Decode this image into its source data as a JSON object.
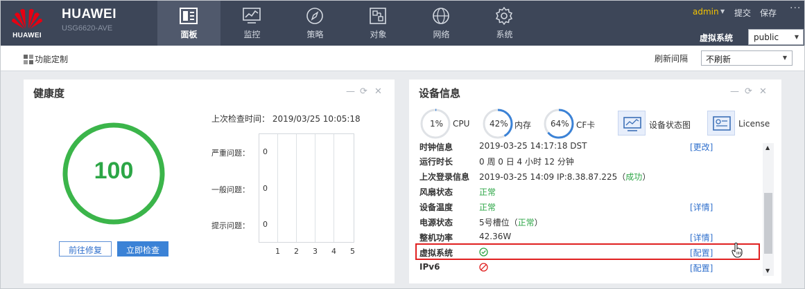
{
  "header": {
    "logo_text": "HUAWEI",
    "brand": "HUAWEI",
    "model": "USG6620-AVE",
    "nav": [
      {
        "label": "面板",
        "icon": "dashboard-icon",
        "active": true
      },
      {
        "label": "监控",
        "icon": "monitor-icon",
        "active": false
      },
      {
        "label": "策略",
        "icon": "compass-icon",
        "active": false
      },
      {
        "label": "对象",
        "icon": "object-icon",
        "active": false
      },
      {
        "label": "网络",
        "icon": "globe-icon",
        "active": false
      },
      {
        "label": "系统",
        "icon": "gear-icon",
        "active": false
      }
    ],
    "user": "admin",
    "submit": "提交",
    "save": "保存",
    "more": "···",
    "vsys_label": "虚拟系统",
    "vsys_value": "public"
  },
  "toolbar": {
    "custom_label": "功能定制",
    "refresh_label": "刷新间隔",
    "refresh_value": "不刷新"
  },
  "health": {
    "title": "健康度",
    "score": "100",
    "last_check": "上次检查时间： 2019/03/25 10:05:18",
    "issues": [
      {
        "label": "严重问题：",
        "value": "0"
      },
      {
        "label": "一般问题：",
        "value": "0"
      },
      {
        "label": "提示问题：",
        "value": "0"
      }
    ],
    "x_ticks": [
      "1",
      "2",
      "3",
      "4",
      "5"
    ],
    "fix_button": "前往修复",
    "check_button": "立即检查",
    "controls": {
      "minimize": "—",
      "refresh": "⟳",
      "close": "✕"
    }
  },
  "device": {
    "title": "设备信息",
    "gauges": [
      {
        "value": "1%",
        "percent": 1,
        "label": "CPU"
      },
      {
        "value": "42%",
        "percent": 42,
        "label": "内存"
      },
      {
        "value": "64%",
        "percent": 64,
        "label": "CF卡"
      }
    ],
    "status_map_label": "设备状态图",
    "license_label": "License",
    "rows": [
      {
        "key": "时钟信息",
        "value": "2019-03-25 14:17:18 DST",
        "link": "[更改]"
      },
      {
        "key": "运行时长",
        "value": "0 周 0 日 4 小时 12 分钟",
        "link": ""
      },
      {
        "key": "上次登录信息",
        "value": "2019-03-25 14:09 IP:8.38.87.225（",
        "ok": "成功",
        "suffix": "）",
        "link": ""
      },
      {
        "key": "风扇状态",
        "value": "",
        "ok": "正常",
        "link": ""
      },
      {
        "key": "设备温度",
        "value": "",
        "ok": "正常",
        "link": "[详情]"
      },
      {
        "key": "电源状态",
        "value": "5号槽位（",
        "ok": "正常",
        "suffix": "）",
        "link": ""
      },
      {
        "key": "整机功率",
        "value": "42.36W",
        "link": "[详情]"
      },
      {
        "key": "虚拟系统",
        "value": "",
        "link": "[配置]"
      },
      {
        "key": "IPv6",
        "value": "",
        "link": "[配置]"
      }
    ],
    "controls": {
      "minimize": "—",
      "refresh": "⟳",
      "close": "✕"
    }
  },
  "colors": {
    "topbar": "#3d4658",
    "accent": "#3b82d6",
    "ok": "#2ca646",
    "alert": "#e01f1f",
    "user": "#f5c400"
  }
}
